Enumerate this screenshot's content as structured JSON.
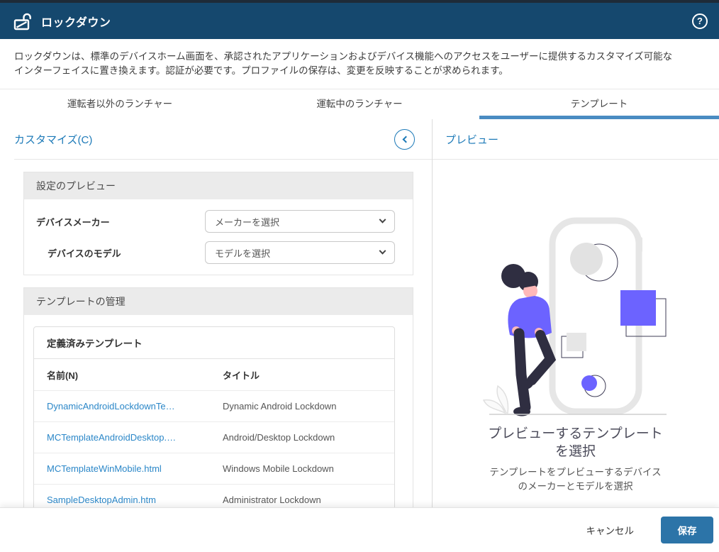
{
  "header": {
    "title": "ロックダウン",
    "help_icon": "?"
  },
  "description": {
    "lines": [
      "ロックダウンは、標準のデバイスホーム画面を、承認されたアプリケーションおよびデバイス機能へのアクセスをユーザーに提供するカスタマイズ可能な",
      "インターフェイスに置き換えます。認証が必要です。プロファイルの保存は、変更を反映することが求められます。"
    ]
  },
  "tabs": [
    {
      "label": "運転者以外のランチャー",
      "active": false
    },
    {
      "label": "運転中のランチャー",
      "active": false
    },
    {
      "label": "テンプレート",
      "active": true
    }
  ],
  "left_panel": {
    "title": "カスタマイズ(C)",
    "preview_settings": {
      "header": "設定のプレビュー",
      "fields": [
        {
          "label": "デバイスメーカー",
          "value": "メーカーを選択"
        },
        {
          "label": "デバイスのモデル",
          "value": "モデルを選択"
        }
      ]
    },
    "template_management": {
      "header": "テンプレートの管理",
      "card_title": "定義済みテンプレート",
      "columns": {
        "name": "名前(N)",
        "title": "タイトル"
      },
      "rows": [
        {
          "name": "DynamicAndroidLockdownTe…",
          "title": "Dynamic Android Lockdown"
        },
        {
          "name": "MCTemplateAndroidDesktop.…",
          "title": "Android/Desktop Lockdown"
        },
        {
          "name": "MCTemplateWinMobile.html",
          "title": "Windows Mobile Lockdown"
        },
        {
          "name": "SampleDesktopAdmin.htm",
          "title": "Administrator Lockdown"
        }
      ]
    }
  },
  "right_panel": {
    "title": "プレビュー",
    "empty_state": {
      "heading_line1": "プレビューするテンプレート",
      "heading_line2": "を選択",
      "subtext_line1": "テンプレートをプレビューするデバイス",
      "subtext_line2": "のメーカーとモデルを選択"
    }
  },
  "footer": {
    "cancel_label": "キャンセル",
    "save_label": "保存"
  },
  "colors": {
    "header_bg": "#15486e",
    "accent_blue": "#1d7ab8",
    "link_blue": "#2b87c8",
    "tab_underline": "#4a8cc2",
    "save_button": "#2c74a8",
    "illustration_purple": "#6c63ff",
    "illustration_dark": "#2f2e41"
  }
}
